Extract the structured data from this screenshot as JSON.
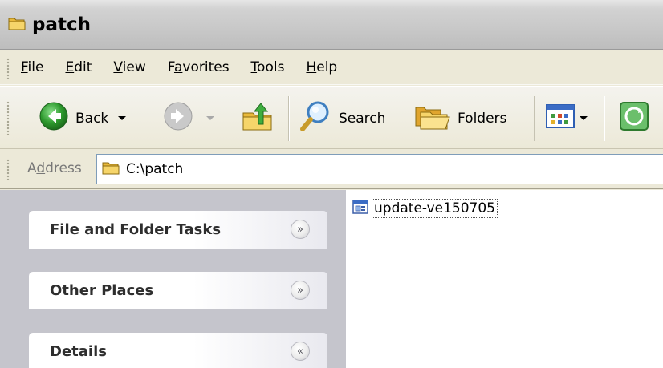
{
  "window": {
    "title": "patch"
  },
  "menu": {
    "items": [
      {
        "label_u": "F",
        "label_rest": "ile"
      },
      {
        "label_u": "E",
        "label_rest": "dit"
      },
      {
        "label_u": "V",
        "label_rest": "iew"
      },
      {
        "label_pre": "F",
        "label_u": "a",
        "label_rest": "vorites"
      },
      {
        "label_u": "T",
        "label_rest": "ools"
      },
      {
        "label_u": "H",
        "label_rest": "elp"
      }
    ]
  },
  "toolbar": {
    "back_label": "Back",
    "search_label": "Search",
    "folders_label": "Folders"
  },
  "address": {
    "label_pre": "A",
    "label_u": "d",
    "label_rest": "dress",
    "value": "C:\\patch"
  },
  "taskpane": {
    "groups": [
      {
        "title": "File and Folder Tasks",
        "chevron": "»"
      },
      {
        "title": "Other Places",
        "chevron": "»"
      },
      {
        "title": "Details",
        "chevron": "«"
      }
    ]
  },
  "files": [
    {
      "name": "update-ve150705"
    }
  ],
  "colors": {
    "back_green": "#2e9a2e",
    "folder_yellow": "#f2c94c",
    "taskpane_bg": "#c5c5cc"
  }
}
